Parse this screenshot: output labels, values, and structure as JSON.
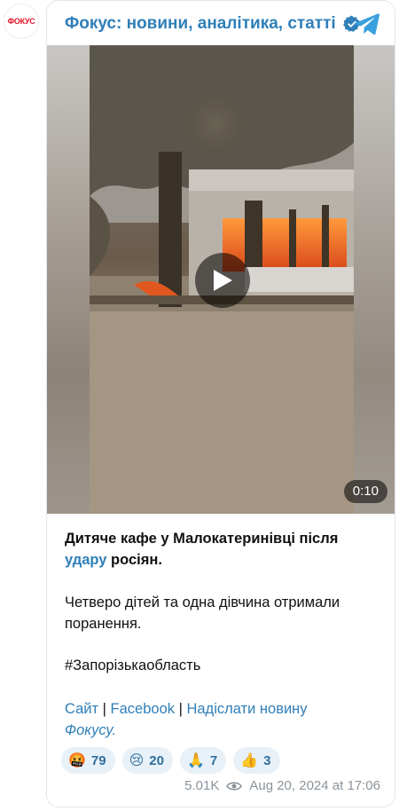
{
  "avatar": {
    "text": "ФОКУС"
  },
  "header": {
    "channel_name": "Фокус: новини, аналітика, статті",
    "verified_icon": "verified-badge-icon",
    "telegram_icon": "telegram-icon"
  },
  "video": {
    "duration": "0:10"
  },
  "post": {
    "line1_start": "Дитяче кафе у Малокатеринівці після",
    "line2_link": "удару",
    "line2_end": " росіян.",
    "paragraph2": "Четверо дітей та одна дівчина отримали поранення.",
    "hashtag": "#Запорізькаобласть",
    "link_site": "Сайт",
    "sep1": " | ",
    "link_facebook": "Facebook",
    "sep2": " | ",
    "link_submit": "Надіслати новину",
    "link_submit_2": "Фокусу."
  },
  "reactions": [
    {
      "emoji": "🤬",
      "count": "79"
    },
    {
      "emoji": "😢",
      "count": "20"
    },
    {
      "emoji": "🙏",
      "count": "7"
    },
    {
      "emoji": "👍",
      "count": "3"
    }
  ],
  "meta": {
    "views": "5.01K",
    "date": "Aug 20, 2024 at 17:06"
  },
  "colors": {
    "accent": "#2f7fb8",
    "reaction_bg": "#e8f1f8",
    "brand_red": "#e3162b"
  }
}
